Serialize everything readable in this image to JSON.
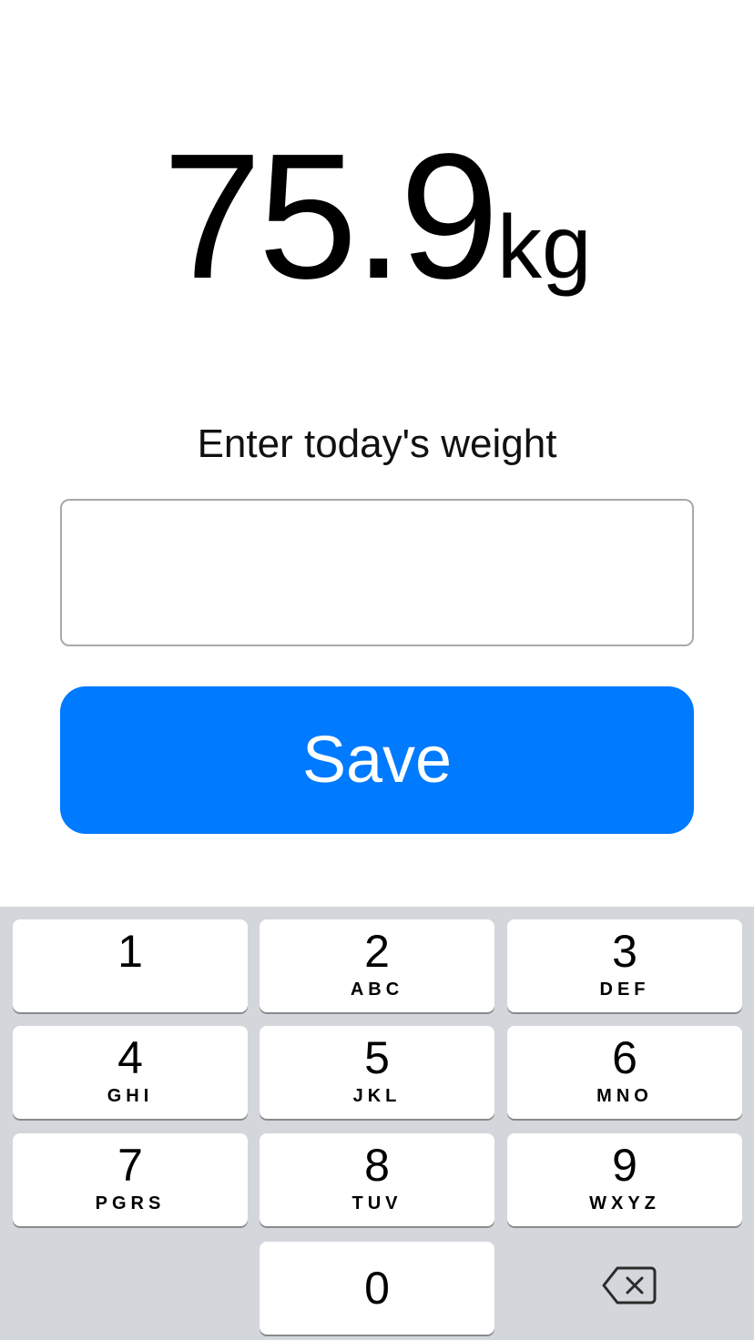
{
  "weight": {
    "value": "75.9",
    "unit": "kg"
  },
  "form": {
    "prompt": "Enter today's weight",
    "input_value": "",
    "save_label": "Save"
  },
  "colors": {
    "accent": "#007aff",
    "keyboard_bg": "#d3d6db"
  },
  "keypad": {
    "keys": [
      {
        "digit": "1",
        "letters": ""
      },
      {
        "digit": "2",
        "letters": "ABC"
      },
      {
        "digit": "3",
        "letters": "DEF"
      },
      {
        "digit": "4",
        "letters": "GHI"
      },
      {
        "digit": "5",
        "letters": "JKL"
      },
      {
        "digit": "6",
        "letters": "MNO"
      },
      {
        "digit": "7",
        "letters": "PGRS"
      },
      {
        "digit": "8",
        "letters": "TUV"
      },
      {
        "digit": "9",
        "letters": "WXYZ"
      },
      {
        "digit": "0",
        "letters": ""
      }
    ],
    "delete_icon": "backspace-icon"
  }
}
